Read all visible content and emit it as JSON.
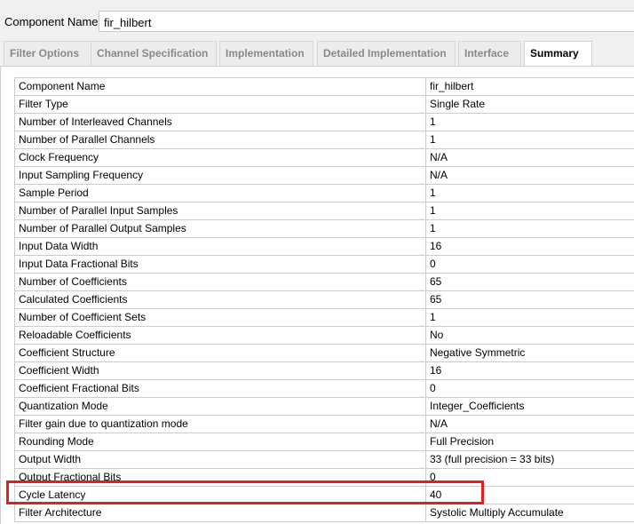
{
  "header": {
    "component_name_label": "Component Name",
    "component_name_value": "fir_hilbert"
  },
  "tabs": [
    {
      "label": "Filter Options",
      "active": false
    },
    {
      "label": "Channel Specification",
      "active": false
    },
    {
      "label": "Implementation",
      "active": false
    },
    {
      "label": "Detailed Implementation",
      "active": false
    },
    {
      "label": "Interface",
      "active": false
    },
    {
      "label": "Summary",
      "active": true
    }
  ],
  "summary": {
    "rows": [
      {
        "param": "Component Name",
        "value": "fir_hilbert"
      },
      {
        "param": "Filter Type",
        "value": "Single Rate"
      },
      {
        "param": "Number of Interleaved Channels",
        "value": "1"
      },
      {
        "param": "Number of Parallel Channels",
        "value": "1"
      },
      {
        "param": "Clock Frequency",
        "value": "N/A"
      },
      {
        "param": "Input Sampling Frequency",
        "value": "N/A"
      },
      {
        "param": "Sample Period",
        "value": "1"
      },
      {
        "param": "Number of Parallel Input Samples",
        "value": "1"
      },
      {
        "param": "Number of Parallel Output Samples",
        "value": "1"
      },
      {
        "param": "Input Data Width",
        "value": "16"
      },
      {
        "param": "Input Data Fractional Bits",
        "value": "0"
      },
      {
        "param": "Number of Coefficients",
        "value": "65"
      },
      {
        "param": "Calculated Coefficients",
        "value": "65"
      },
      {
        "param": "Number of Coefficient Sets",
        "value": "1"
      },
      {
        "param": "Reloadable Coefficients",
        "value": "No"
      },
      {
        "param": "Coefficient Structure",
        "value": "Negative Symmetric"
      },
      {
        "param": "Coefficient Width",
        "value": "16"
      },
      {
        "param": "Coefficient Fractional Bits",
        "value": "0"
      },
      {
        "param": "Quantization Mode",
        "value": "Integer_Coefficients"
      },
      {
        "param": "Filter gain due to quantization mode",
        "value": "N/A"
      },
      {
        "param": "Rounding Mode",
        "value": "Full Precision"
      },
      {
        "param": "Output Width",
        "value": "33 (full precision = 33 bits)"
      },
      {
        "param": "Output Fractional Bits",
        "value": "0"
      },
      {
        "param": "Cycle Latency",
        "value": "40"
      },
      {
        "param": "Filter Architecture",
        "value": "Systolic Multiply Accumulate"
      }
    ],
    "highlighted_row": "Cycle Latency",
    "highlight_color": "#e02020"
  }
}
